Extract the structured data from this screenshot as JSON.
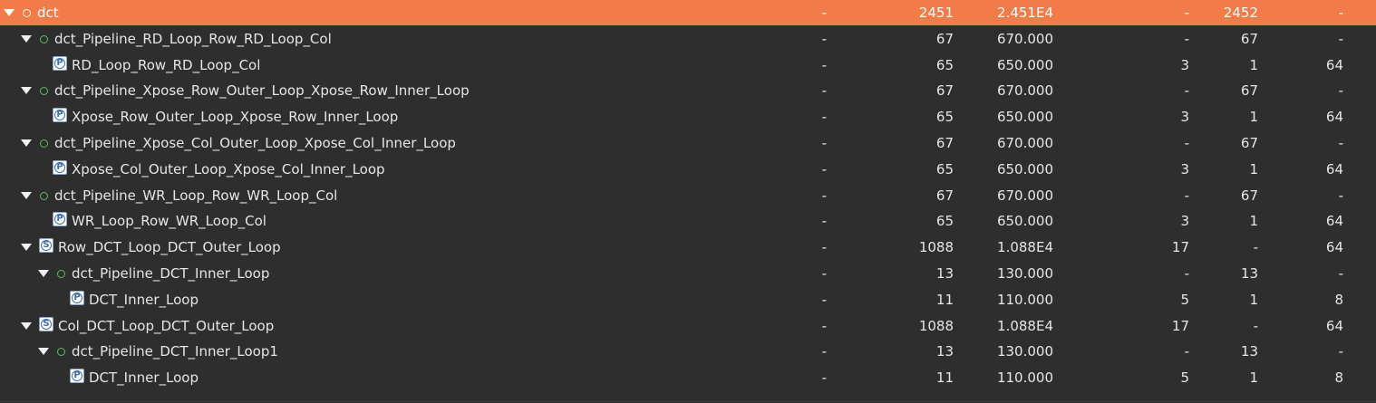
{
  "tree": {
    "rows": [
      {
        "name": "dct",
        "icon": "green-circle",
        "expanded": true,
        "selected": true,
        "col1": "-",
        "col2": "2451",
        "col3": "2.451E4",
        "col4": "-",
        "col5": "2452",
        "col6": "-"
      },
      {
        "name": "dct_Pipeline_RD_Loop_Row_RD_Loop_Col",
        "icon": "green-circle",
        "expanded": true,
        "col1": "-",
        "col2": "67",
        "col3": "670.000",
        "col4": "-",
        "col5": "67",
        "col6": "-"
      },
      {
        "name": "RD_Loop_Row_RD_Loop_Col",
        "icon": "pipeline-loop-P",
        "icon_letter": "P",
        "col1": "-",
        "col2": "65",
        "col3": "650.000",
        "col4": "3",
        "col5": "1",
        "col6": "64"
      },
      {
        "name": "dct_Pipeline_Xpose_Row_Outer_Loop_Xpose_Row_Inner_Loop",
        "icon": "green-circle",
        "expanded": true,
        "col1": "-",
        "col2": "67",
        "col3": "670.000",
        "col4": "-",
        "col5": "67",
        "col6": "-"
      },
      {
        "name": "Xpose_Row_Outer_Loop_Xpose_Row_Inner_Loop",
        "icon": "pipeline-loop-P",
        "icon_letter": "P",
        "col1": "-",
        "col2": "65",
        "col3": "650.000",
        "col4": "3",
        "col5": "1",
        "col6": "64"
      },
      {
        "name": "dct_Pipeline_Xpose_Col_Outer_Loop_Xpose_Col_Inner_Loop",
        "icon": "green-circle",
        "expanded": true,
        "col1": "-",
        "col2": "67",
        "col3": "670.000",
        "col4": "-",
        "col5": "67",
        "col6": "-"
      },
      {
        "name": "Xpose_Col_Outer_Loop_Xpose_Col_Inner_Loop",
        "icon": "pipeline-loop-P",
        "icon_letter": "P",
        "col1": "-",
        "col2": "65",
        "col3": "650.000",
        "col4": "3",
        "col5": "1",
        "col6": "64"
      },
      {
        "name": "dct_Pipeline_WR_Loop_Row_WR_Loop_Col",
        "icon": "green-circle",
        "expanded": true,
        "col1": "-",
        "col2": "67",
        "col3": "670.000",
        "col4": "-",
        "col5": "67",
        "col6": "-"
      },
      {
        "name": "WR_Loop_Row_WR_Loop_Col",
        "icon": "pipeline-loop-P",
        "icon_letter": "P",
        "col1": "-",
        "col2": "65",
        "col3": "650.000",
        "col4": "3",
        "col5": "1",
        "col6": "64"
      },
      {
        "name": "Row_DCT_Loop_DCT_Outer_Loop",
        "icon": "sequential-loop-S",
        "icon_letter": "S",
        "expanded": true,
        "col1": "-",
        "col2": "1088",
        "col3": "1.088E4",
        "col4": "17",
        "col5": "-",
        "col6": "64"
      },
      {
        "name": "dct_Pipeline_DCT_Inner_Loop",
        "icon": "green-circle",
        "expanded": true,
        "col1": "-",
        "col2": "13",
        "col3": "130.000",
        "col4": "-",
        "col5": "13",
        "col6": "-"
      },
      {
        "name": "DCT_Inner_Loop",
        "icon": "pipeline-loop-P",
        "icon_letter": "P",
        "col1": "-",
        "col2": "11",
        "col3": "110.000",
        "col4": "5",
        "col5": "1",
        "col6": "8"
      },
      {
        "name": "Col_DCT_Loop_DCT_Outer_Loop",
        "icon": "sequential-loop-S",
        "icon_letter": "S",
        "expanded": true,
        "col1": "-",
        "col2": "1088",
        "col3": "1.088E4",
        "col4": "17",
        "col5": "-",
        "col6": "64"
      },
      {
        "name": "dct_Pipeline_DCT_Inner_Loop1",
        "icon": "green-circle",
        "expanded": true,
        "col1": "-",
        "col2": "13",
        "col3": "130.000",
        "col4": "-",
        "col5": "13",
        "col6": "-"
      },
      {
        "name": "DCT_Inner_Loop",
        "icon": "pipeline-loop-P",
        "icon_letter": "P",
        "col1": "-",
        "col2": "11",
        "col3": "110.000",
        "col4": "5",
        "col5": "1",
        "col6": "8"
      }
    ]
  },
  "colors": {
    "background": "#2e2e2e",
    "selected_row": "#f27b4a",
    "text": "#e6e6e6",
    "status_dot": "#5dbb5d",
    "loop_icon": "#3f6fae"
  }
}
